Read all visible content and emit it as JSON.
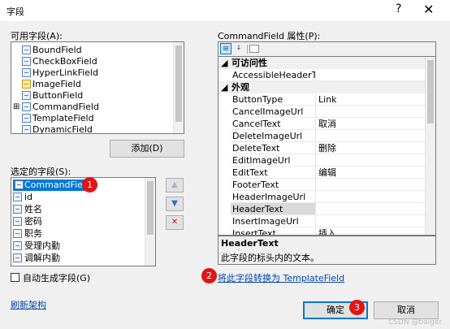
{
  "dialog": {
    "title": "字段",
    "help_glyph": "?",
    "close_glyph": "✕"
  },
  "available": {
    "label": "可用字段(A):",
    "items": [
      {
        "label": "BoundField"
      },
      {
        "label": "CheckBoxField"
      },
      {
        "label": "HyperLinkField"
      },
      {
        "label": "ImageField"
      },
      {
        "label": "ButtonField"
      },
      {
        "label": "CommandField"
      },
      {
        "label": "TemplateField"
      },
      {
        "label": "DynamicField"
      }
    ],
    "expand_glyph": "⊞"
  },
  "add_button": {
    "label": "添加(D)"
  },
  "selected": {
    "label": "选定的字段(S):",
    "items": [
      {
        "label": "CommandField"
      },
      {
        "label": "id"
      },
      {
        "label": "姓名"
      },
      {
        "label": "密码"
      },
      {
        "label": "职务"
      },
      {
        "label": "受理内勤"
      },
      {
        "label": "调解内勤"
      }
    ]
  },
  "move_buttons": {
    "up": "▲",
    "down": "▼",
    "delete": "✕"
  },
  "autogen": {
    "label": "自动生成字段(G)",
    "checked": false
  },
  "refresh_link": {
    "label": "刷新架构"
  },
  "properties": {
    "label": "CommandField 属性(P):",
    "rows": [
      {
        "type": "category",
        "name": "可访问性"
      },
      {
        "type": "prop",
        "name": "AccessibleHeaderText",
        "value": ""
      },
      {
        "type": "category",
        "name": "外观"
      },
      {
        "type": "prop",
        "name": "ButtonType",
        "value": "Link"
      },
      {
        "type": "prop",
        "name": "CancelImageUrl",
        "value": ""
      },
      {
        "type": "prop",
        "name": "CancelText",
        "value": "取消"
      },
      {
        "type": "prop",
        "name": "DeleteImageUrl",
        "value": ""
      },
      {
        "type": "prop",
        "name": "DeleteText",
        "value": "删除"
      },
      {
        "type": "prop",
        "name": "EditImageUrl",
        "value": ""
      },
      {
        "type": "prop",
        "name": "EditText",
        "value": "编辑"
      },
      {
        "type": "prop",
        "name": "FooterText",
        "value": ""
      },
      {
        "type": "prop",
        "name": "HeaderImageUrl",
        "value": ""
      },
      {
        "type": "prop",
        "name": "HeaderText",
        "value": ""
      },
      {
        "type": "prop",
        "name": "InsertImageUrl",
        "value": ""
      },
      {
        "type": "prop",
        "name": "InsertText",
        "value": "插入"
      }
    ],
    "description_title": "HeaderText",
    "description_text": "此字段的标头内的文本。"
  },
  "convert_link": {
    "label": "将此字段转换为 TemplateField"
  },
  "ok_button": {
    "label": "确定"
  },
  "cancel_button": {
    "label": "取消"
  },
  "badges": [
    "1",
    "2",
    "3"
  ],
  "watermark": "CSDN @baiger",
  "colors": {
    "accent": "#0078d7",
    "selection": "#0078d7",
    "badge": "#e11515",
    "link": "#0645ad"
  }
}
